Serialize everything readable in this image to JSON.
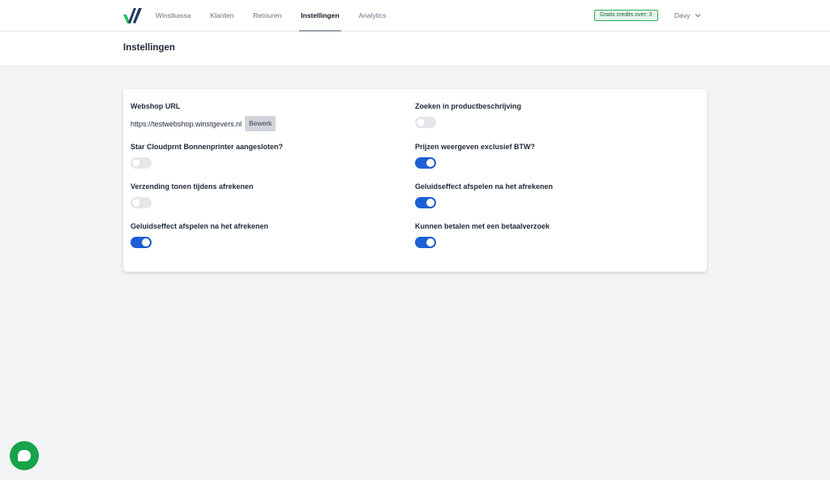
{
  "nav": {
    "items": [
      {
        "label": "Winstkassa",
        "active": false
      },
      {
        "label": "Klanten",
        "active": false
      },
      {
        "label": "Retouren",
        "active": false
      },
      {
        "label": "Instellingen",
        "active": true
      },
      {
        "label": "Analytics",
        "active": false
      }
    ]
  },
  "credits_badge": "Gratis credits over: 3",
  "user": {
    "name": "Davy",
    "icon": "chevron-down-icon"
  },
  "page_title": "Instellingen",
  "settings": {
    "webshop_url": {
      "label": "Webshop URL",
      "value": "https://testwebshop.winstgevers.nl",
      "edit_label": "Bewerk"
    },
    "left": [
      {
        "label": "Star Cloudprnt Bonnenprinter aangesloten?",
        "on": false
      },
      {
        "label": "Verzending tonen tijdens afrekenen",
        "on": false
      },
      {
        "label": "Geluidseffect afspelen na het afrekenen",
        "on": true
      }
    ],
    "right": [
      {
        "label": "Zoeken in productbeschrijving",
        "on": false
      },
      {
        "label": "Prijzen weergeven exclusief BTW?",
        "on": true
      },
      {
        "label": "Geluidseffect afspelen na het afrekenen",
        "on": true
      },
      {
        "label": "Kunnen betalen met een betaalverzoek",
        "on": true
      }
    ]
  },
  "colors": {
    "accent": "#1d5fd6",
    "credits_border": "#34a853",
    "chat": "#16a34a"
  }
}
